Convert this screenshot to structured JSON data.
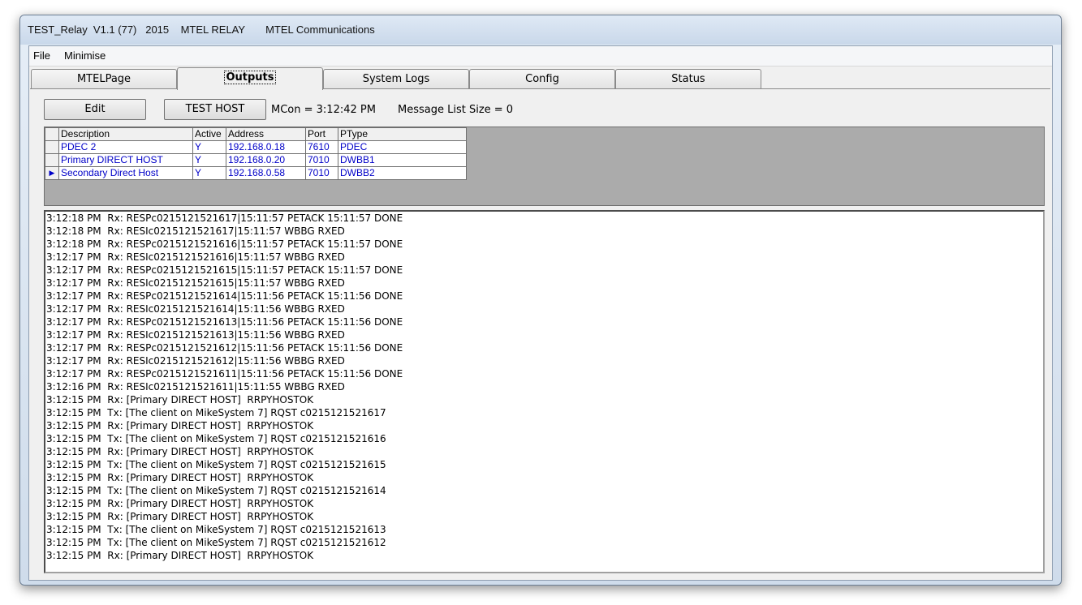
{
  "window": {
    "title": "TEST_Relay  V1.1 (77)   2015    MTEL RELAY       MTEL Communications"
  },
  "menu": [
    "File",
    "Minimise"
  ],
  "tabs": [
    {
      "label": "MTELPage",
      "active": false
    },
    {
      "label": "Outputs",
      "active": true
    },
    {
      "label": "System Logs",
      "active": false
    },
    {
      "label": "Config",
      "active": false
    },
    {
      "label": "Status",
      "active": false
    }
  ],
  "toolbar": {
    "edit_label": "Edit",
    "test_host_label": "TEST HOST",
    "mcon_text": "MCon = 3:12:42 PM",
    "msg_list_text": "Message List Size = 0"
  },
  "grid": {
    "headers": [
      "Description",
      "Active",
      "Address",
      "Port",
      "PType"
    ],
    "rows": [
      {
        "description": "PDEC 2",
        "active": "Y",
        "address": "192.168.0.18",
        "port": "7610",
        "ptype": "PDEC",
        "selected": false
      },
      {
        "description": "Primary DIRECT HOST",
        "active": "Y",
        "address": "192.168.0.20",
        "port": "7010",
        "ptype": "DWBB1",
        "selected": false
      },
      {
        "description": "Secondary Direct Host",
        "active": "Y",
        "address": "192.168.0.58",
        "port": "7010",
        "ptype": "DWBB2",
        "selected": true
      }
    ]
  },
  "log_lines": [
    "3:12:18 PM  Rx: RESPc0215121521617|15:11:57 PETACK 15:11:57 DONE",
    "3:12:18 PM  Rx: RESIc0215121521617|15:11:57 WBBG RXED",
    "3:12:18 PM  Rx: RESPc0215121521616|15:11:57 PETACK 15:11:57 DONE",
    "3:12:17 PM  Rx: RESIc0215121521616|15:11:57 WBBG RXED",
    "3:12:17 PM  Rx: RESPc0215121521615|15:11:57 PETACK 15:11:57 DONE",
    "3:12:17 PM  Rx: RESIc0215121521615|15:11:57 WBBG RXED",
    "3:12:17 PM  Rx: RESPc0215121521614|15:11:56 PETACK 15:11:56 DONE",
    "3:12:17 PM  Rx: RESIc0215121521614|15:11:56 WBBG RXED",
    "3:12:17 PM  Rx: RESPc0215121521613|15:11:56 PETACK 15:11:56 DONE",
    "3:12:17 PM  Rx: RESIc0215121521613|15:11:56 WBBG RXED",
    "3:12:17 PM  Rx: RESPc0215121521612|15:11:56 PETACK 15:11:56 DONE",
    "3:12:17 PM  Rx: RESIc0215121521612|15:11:56 WBBG RXED",
    "3:12:17 PM  Rx: RESPc0215121521611|15:11:56 PETACK 15:11:56 DONE",
    "3:12:16 PM  Rx: RESIc0215121521611|15:11:55 WBBG RXED",
    "3:12:15 PM  Rx: [Primary DIRECT HOST]  RRPYHOSTOK",
    "3:12:15 PM  Tx: [The client on MikeSystem 7] RQST c0215121521617",
    "3:12:15 PM  Rx: [Primary DIRECT HOST]  RRPYHOSTOK",
    "3:12:15 PM  Tx: [The client on MikeSystem 7] RQST c0215121521616",
    "3:12:15 PM  Rx: [Primary DIRECT HOST]  RRPYHOSTOK",
    "3:12:15 PM  Tx: [The client on MikeSystem 7] RQST c0215121521615",
    "3:12:15 PM  Rx: [Primary DIRECT HOST]  RRPYHOSTOK",
    "3:12:15 PM  Tx: [The client on MikeSystem 7] RQST c0215121521614",
    "3:12:15 PM  Rx: [Primary DIRECT HOST]  RRPYHOSTOK",
    "3:12:15 PM  Rx: [Primary DIRECT HOST]  RRPYHOSTOK",
    "3:12:15 PM  Tx: [The client on MikeSystem 7] RQST c0215121521613",
    "3:12:15 PM  Tx: [The client on MikeSystem 7] RQST c0215121521612",
    "3:12:15 PM  Rx: [Primary DIRECT HOST]  RRPYHOSTOK"
  ]
}
